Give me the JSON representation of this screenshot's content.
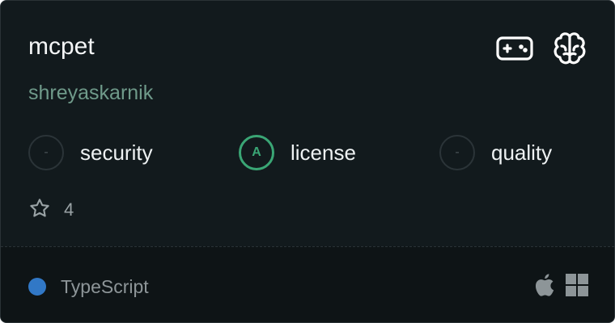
{
  "card": {
    "name": "mcpet",
    "owner": "shreyaskarnik",
    "category_icons": [
      "gamepad-icon",
      "brain-icon"
    ]
  },
  "scores": [
    {
      "label": "security",
      "grade": "-",
      "status": "none"
    },
    {
      "label": "license",
      "grade": "A",
      "status": "good"
    },
    {
      "label": "quality",
      "grade": "-",
      "status": "none"
    }
  ],
  "stars": {
    "icon": "star-icon",
    "count": "4"
  },
  "footer": {
    "language": "TypeScript",
    "language_color": "#3178c6",
    "platforms": [
      "apple-icon",
      "windows-icon"
    ]
  },
  "colors": {
    "background": "#121a1d",
    "accent_good": "#3aa675",
    "owner": "#6f9a8a"
  }
}
